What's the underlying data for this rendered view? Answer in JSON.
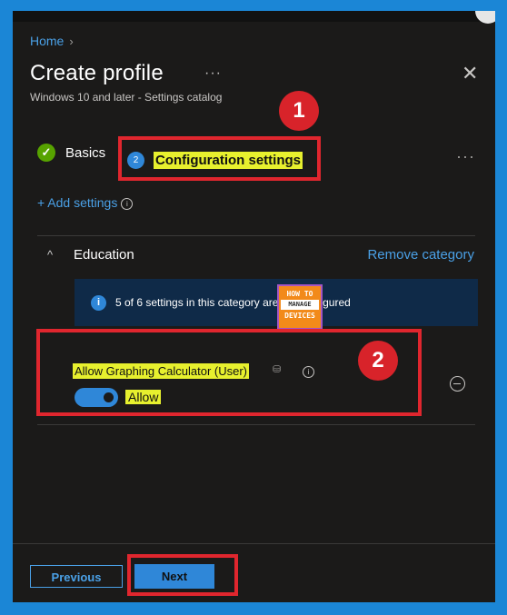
{
  "breadcrumb": {
    "home": "Home",
    "chevron": "›"
  },
  "header": {
    "title": "Create profile",
    "more": "···",
    "subtitle": "Windows 10 and later - Settings catalog",
    "close": "✕"
  },
  "tabs": {
    "basics": {
      "label": "Basics",
      "icon": "checkmark-icon"
    },
    "configuration": {
      "label": "Configuration settings",
      "step": "2"
    },
    "more": "···"
  },
  "add_settings": {
    "label": "+ Add settings",
    "info": "i"
  },
  "category": {
    "chevron": "^",
    "name": "Education",
    "remove": "Remove category"
  },
  "infobar": {
    "icon": "i",
    "text": "5 of 6 settings in this category are not configured"
  },
  "logo": {
    "line1": "HOW TO",
    "line2": "MANAGE",
    "line3": "DEVICES"
  },
  "setting": {
    "name": "Allow Graphing Calculator (User)",
    "info": "i",
    "toggle_on": true,
    "value": "Allow"
  },
  "footer": {
    "previous": "Previous",
    "next": "Next"
  },
  "annotations": {
    "one": "1",
    "two": "2"
  },
  "colors": {
    "accent": "#2f87d8",
    "highlight": "#e7f02e",
    "annotation": "#e0262e",
    "frame": "#1b86d6"
  }
}
